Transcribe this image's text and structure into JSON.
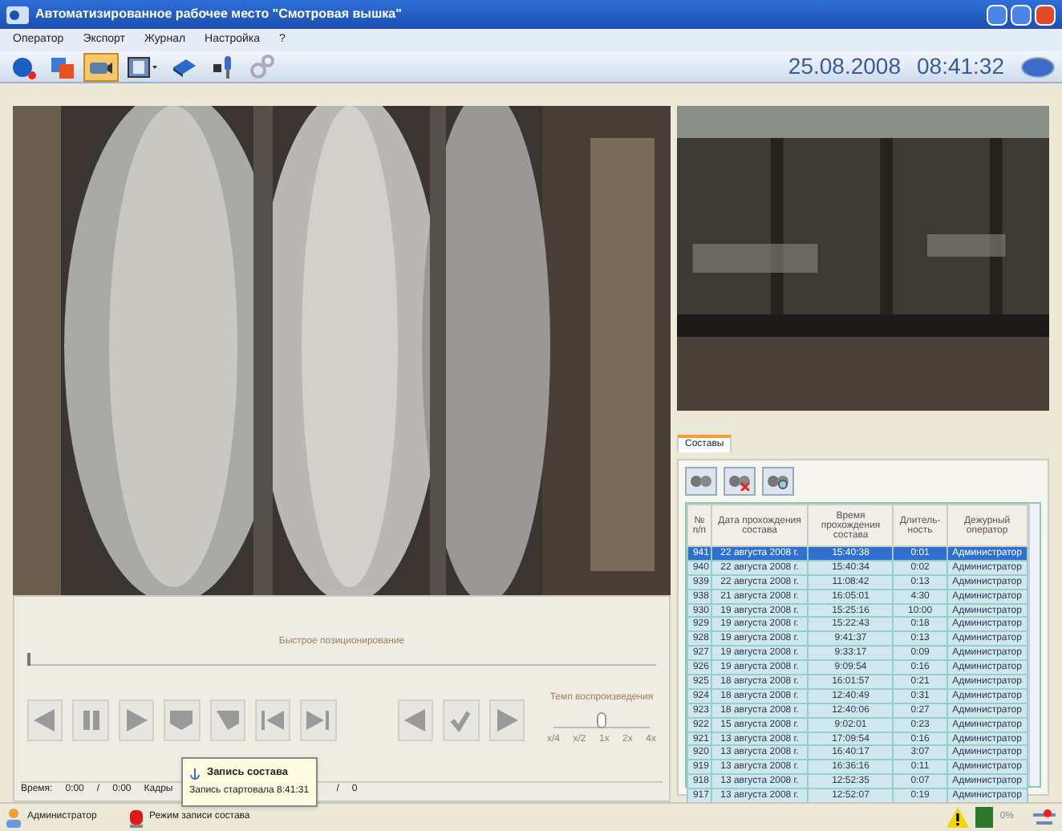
{
  "window": {
    "title": "Автоматизированное рабочее место \"Смотровая вышка\""
  },
  "menu": [
    "Оператор",
    "Экспорт",
    "Журнал",
    "Настройка",
    "?"
  ],
  "toolbar": {
    "items": [
      {
        "kind": "record",
        "selected": false
      },
      {
        "kind": "export",
        "selected": false
      },
      {
        "kind": "camera",
        "selected": true
      },
      {
        "kind": "film",
        "selected": false
      },
      {
        "kind": "book",
        "selected": false
      },
      {
        "kind": "mic",
        "selected": false
      },
      {
        "kind": "gears",
        "selected": false
      }
    ],
    "date": "25.08.2008",
    "time": "08:41:32"
  },
  "player": {
    "seek_label": "Быстрое позиционирование",
    "seek": {
      "level": 0
    },
    "speed_label": "Темп воспроизведения",
    "speed_ticks": [
      "x/4",
      "x/2",
      "1x",
      "2x",
      "4x"
    ],
    "speed": {
      "level": 0.5
    },
    "time_label": "Время:",
    "time_value": "0:00",
    "time_sep": "/",
    "time_total": "0:00",
    "frames_label": "Кадры",
    "frames_sep": "/",
    "frames_total": "0"
  },
  "tooltip": {
    "title": "Запись состава",
    "text": "Запись стартовала 8:41:31"
  },
  "trains": {
    "tab": "Составы",
    "columns": [
      "№ п/п",
      "Дата прохождения состава",
      "Время прохождения состава",
      "Длитель-ность",
      "Дежурный оператор"
    ],
    "rows": [
      {
        "cells": [
          "941",
          "22 августа 2008 г.",
          "15:40:38",
          "0:01",
          "Администратор"
        ],
        "selected": true
      },
      {
        "cells": [
          "940",
          "22 августа 2008 г.",
          "15:40:34",
          "0:02",
          "Администратор"
        ],
        "selected": false
      },
      {
        "cells": [
          "939",
          "22 августа 2008 г.",
          "11:08:42",
          "0:13",
          "Администратор"
        ],
        "selected": false
      },
      {
        "cells": [
          "938",
          "21 августа 2008 г.",
          "16:05:01",
          "4:30",
          "Администратор"
        ],
        "selected": false
      },
      {
        "cells": [
          "930",
          "19 августа 2008 г.",
          "15:25:16",
          "10:00",
          "Администратор"
        ],
        "selected": false
      },
      {
        "cells": [
          "929",
          "19 августа 2008 г.",
          "15:22:43",
          "0:18",
          "Администратор"
        ],
        "selected": false
      },
      {
        "cells": [
          "928",
          "19 августа 2008 г.",
          "9:41:37",
          "0:13",
          "Администратор"
        ],
        "selected": false
      },
      {
        "cells": [
          "927",
          "19 августа 2008 г.",
          "9:33:17",
          "0:09",
          "Администратор"
        ],
        "selected": false
      },
      {
        "cells": [
          "926",
          "19 августа 2008 г.",
          "9:09:54",
          "0:16",
          "Администратор"
        ],
        "selected": false
      },
      {
        "cells": [
          "925",
          "18 августа 2008 г.",
          "16:01:57",
          "0:21",
          "Администратор"
        ],
        "selected": false
      },
      {
        "cells": [
          "924",
          "18 августа 2008 г.",
          "12:40:49",
          "0:31",
          "Администратор"
        ],
        "selected": false
      },
      {
        "cells": [
          "923",
          "18 августа 2008 г.",
          "12:40:06",
          "0:27",
          "Администратор"
        ],
        "selected": false
      },
      {
        "cells": [
          "922",
          "15 августа 2008 г.",
          "9:02:01",
          "0:23",
          "Администратор"
        ],
        "selected": false
      },
      {
        "cells": [
          "921",
          "13 августа 2008 г.",
          "17:09:54",
          "0:16",
          "Администратор"
        ],
        "selected": false
      },
      {
        "cells": [
          "920",
          "13 августа 2008 г.",
          "16:40:17",
          "3:07",
          "Администратор"
        ],
        "selected": false
      },
      {
        "cells": [
          "919",
          "13 августа 2008 г.",
          "16:36:16",
          "0:11",
          "Администратор"
        ],
        "selected": false
      },
      {
        "cells": [
          "918",
          "13 августа 2008 г.",
          "12:52:35",
          "0:07",
          "Администратор"
        ],
        "selected": false
      },
      {
        "cells": [
          "917",
          "13 августа 2008 г.",
          "12:52:07",
          "0:19",
          "Администратор"
        ],
        "selected": false
      }
    ]
  },
  "status_bar": {
    "user": "Администратор",
    "mode": "Режим записи состава",
    "percent": "0%"
  }
}
